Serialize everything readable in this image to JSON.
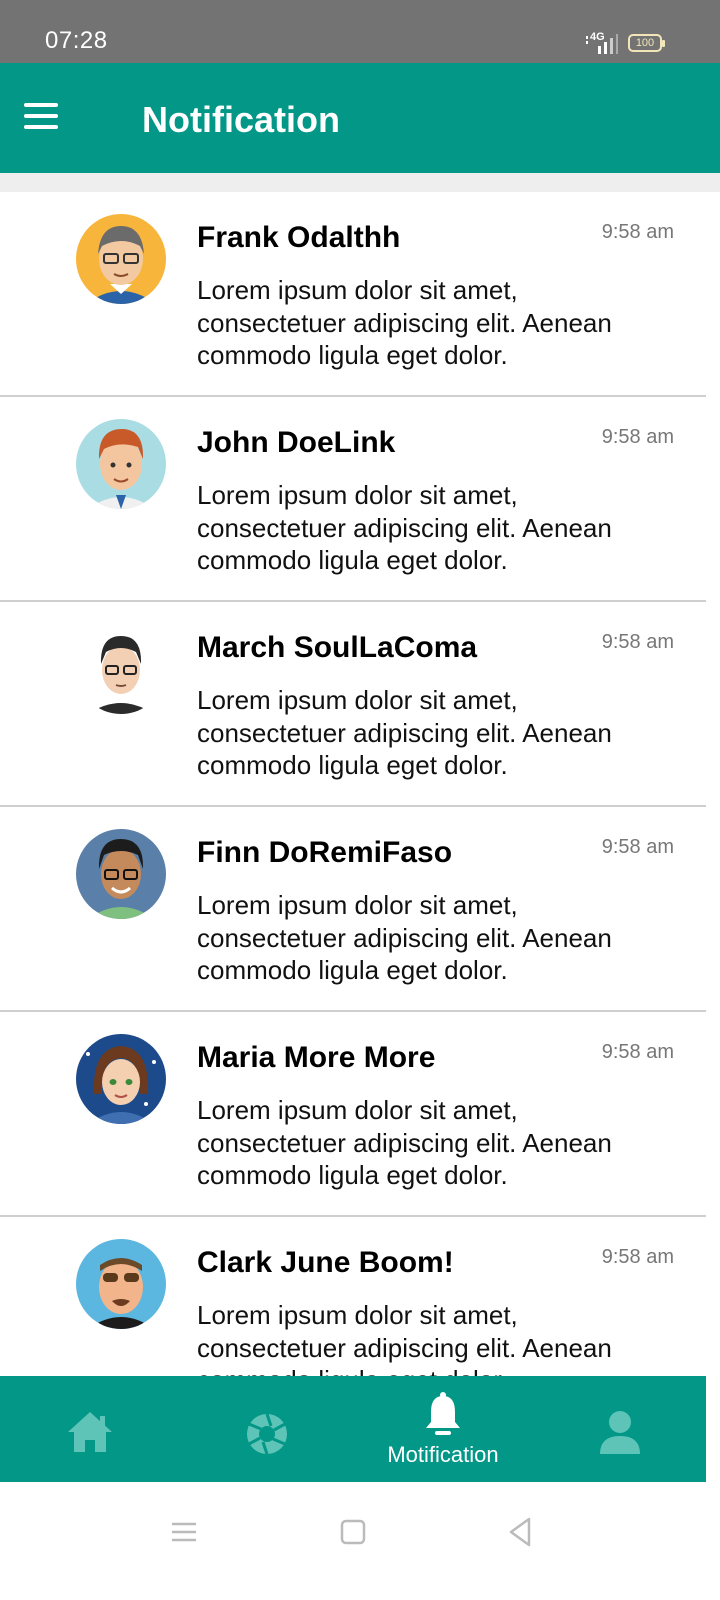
{
  "status_bar": {
    "time": "07:28",
    "network": "4G",
    "battery": "100"
  },
  "app_bar": {
    "title": "Notification"
  },
  "notifications": [
    {
      "name": "Frank Odalthh",
      "time": "9:58 am",
      "message": "Lorem ipsum dolor sit amet, consectetuer adipiscing elit. Aenean commodo ligula eget dolor."
    },
    {
      "name": "John DoeLink",
      "time": "9:58 am",
      "message": "Lorem ipsum dolor sit amet, consectetuer adipiscing elit. Aenean commodo ligula eget dolor."
    },
    {
      "name": "March SoulLaComa",
      "time": "9:58 am",
      "message": "Lorem ipsum dolor sit amet, consectetuer adipiscing elit. Aenean commodo ligula eget dolor."
    },
    {
      "name": "Finn DoRemiFaso",
      "time": "9:58 am",
      "message": "Lorem ipsum dolor sit amet, consectetuer adipiscing elit. Aenean commodo ligula eget dolor."
    },
    {
      "name": "Maria More More",
      "time": "9:58 am",
      "message": "Lorem ipsum dolor sit amet, consectetuer adipiscing elit. Aenean commodo ligula eget dolor."
    },
    {
      "name": "Clark June Boom!",
      "time": "9:58 am",
      "message": "Lorem ipsum dolor sit amet, consectetuer adipiscing elit. Aenean commodo ligula eget dolor."
    }
  ],
  "bottom_nav": {
    "items": [
      {
        "icon": "home-icon",
        "label": ""
      },
      {
        "icon": "aperture-icon",
        "label": ""
      },
      {
        "icon": "bell-icon",
        "label": "Motification",
        "active": true
      },
      {
        "icon": "person-icon",
        "label": ""
      }
    ]
  },
  "colors": {
    "primary": "#039787",
    "status_bar": "#737373",
    "inactive_icon": "#5fc4b8",
    "active_icon": "#ffffff"
  }
}
